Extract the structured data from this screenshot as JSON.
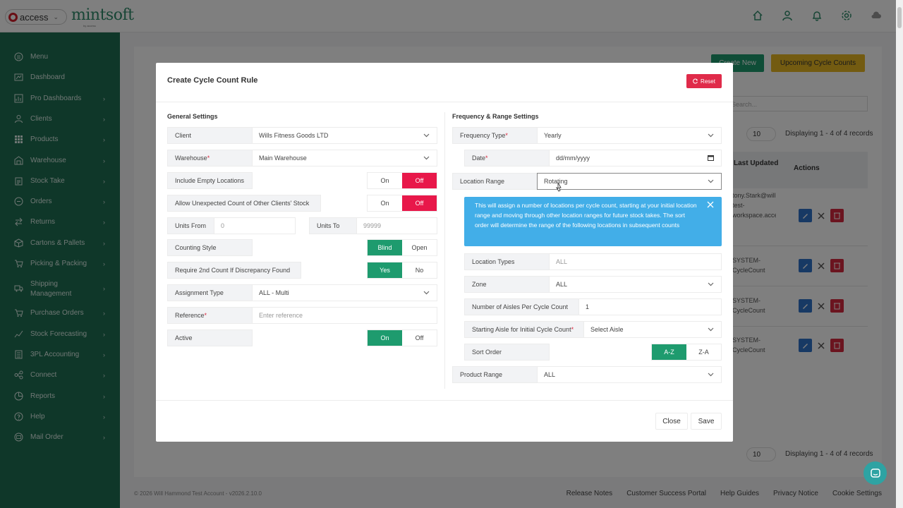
{
  "header": {
    "access_label": "access",
    "brand": "mintsoft",
    "brand_sub": "by access"
  },
  "sidebar": {
    "items": [
      {
        "label": "Menu",
        "icon": "list-icon",
        "chevron": false
      },
      {
        "label": "Dashboard",
        "icon": "dashboard-icon",
        "chevron": false
      },
      {
        "label": "Pro Dashboards",
        "icon": "pro-dashboard-icon",
        "chevron": true
      },
      {
        "label": "Clients",
        "icon": "users-icon",
        "chevron": true
      },
      {
        "label": "Products",
        "icon": "grid-icon",
        "chevron": true
      },
      {
        "label": "Warehouse",
        "icon": "warehouse-icon",
        "chevron": true
      },
      {
        "label": "Stock Take",
        "icon": "clipboard-icon",
        "chevron": true
      },
      {
        "label": "Orders",
        "icon": "orders-icon",
        "chevron": true
      },
      {
        "label": "Returns",
        "icon": "returns-icon",
        "chevron": true
      },
      {
        "label": "Cartons & Pallets",
        "icon": "box-icon",
        "chevron": true
      },
      {
        "label": "Picking & Packing",
        "icon": "cart-icon",
        "chevron": true
      },
      {
        "label": "Shipping",
        "label2": "Management",
        "icon": "truck-icon",
        "chevron": true
      },
      {
        "label": "Purchase Orders",
        "icon": "purchase-icon",
        "chevron": true
      },
      {
        "label": "Stock Forecasting",
        "icon": "forecast-icon",
        "chevron": true
      },
      {
        "label": "3PL Accounting",
        "icon": "accounting-icon",
        "chevron": true
      },
      {
        "label": "Connect",
        "icon": "connect-icon",
        "chevron": true
      },
      {
        "label": "Reports",
        "icon": "reports-icon",
        "chevron": true
      },
      {
        "label": "Help",
        "icon": "help-icon",
        "chevron": true
      },
      {
        "label": "Mail Order",
        "icon": "mail-icon",
        "chevron": true
      }
    ]
  },
  "background": {
    "create_new": "Create New",
    "upcoming": "Upcoming Cycle Counts",
    "search_placeholder": "Search...",
    "page_size": "10",
    "displaying": "Displaying 1 - 4 of 4 records",
    "col_last_updated": "Last Updated",
    "col_actions": "Actions",
    "rows": [
      "tony.Stark@willhammond-test-workspace.accessmyworkspace.com",
      "SYSTEM-CycleCount",
      "SYSTEM-CycleCount",
      "SYSTEM-CycleCount"
    ],
    "footer_copy": "© 2026 Will Hammond Test Account - v2026.2.10.0",
    "footer_links": [
      "Release Notes",
      "Customer Success Portal",
      "Help Guides",
      "Privacy Notice",
      "Cookie Settings"
    ]
  },
  "modal": {
    "title": "Create Cycle Count Rule",
    "reset": "Reset",
    "general_title": "General Settings",
    "frequency_title": "Frequency & Range Settings",
    "client_label": "Client",
    "client_value": "Wills Fitness Goods LTD",
    "warehouse_label": "Warehouse",
    "warehouse_value": "Main Warehouse",
    "include_empty_label": "Include Empty Locations",
    "allow_unexpected_label": "Allow Unexpected Count of Other Clients' Stock",
    "on": "On",
    "off": "Off",
    "units_from_label": "Units From",
    "units_from_placeholder": "0",
    "units_to_label": "Units To",
    "units_to_placeholder": "99999",
    "counting_style_label": "Counting Style",
    "blind": "Blind",
    "open": "Open",
    "require_2nd_label": "Require 2nd Count If Discrepancy Found",
    "yes": "Yes",
    "no": "No",
    "assignment_label": "Assignment Type",
    "assignment_value": "ALL - Multi",
    "reference_label": "Reference",
    "reference_placeholder": "Enter reference",
    "active_label": "Active",
    "frequency_type_label": "Frequency Type",
    "frequency_type_value": "Yearly",
    "date_label": "Date",
    "date_value": "dd/mm/yyyy",
    "location_range_label": "Location Range",
    "location_range_value": "Rotating",
    "info_text": "This will assign a number of locations per cycle count, starting at your initial location range and moving through other location ranges for future stock takes. The sort order will determine the range of the following locations in subsequent counts",
    "location_types_label": "Location Types",
    "location_types_value": "ALL",
    "zone_label": "Zone",
    "zone_value": "ALL",
    "aisles_label": "Number of Aisles Per Cycle Count",
    "aisles_value": "1",
    "starting_aisle_label": "Starting Aisle for Initial Cycle Count",
    "starting_aisle_value": "Select Aisle",
    "sort_order_label": "Sort Order",
    "sort_az": "A-Z",
    "sort_za": "Z-A",
    "product_range_label": "Product Range",
    "product_range_value": "ALL",
    "close": "Close",
    "save": "Save"
  },
  "colors": {
    "sidebar": "#1e6e53",
    "danger": "#e8184a",
    "success": "#1e9b6e",
    "info": "#42aee8",
    "warning": "#e6b623"
  }
}
